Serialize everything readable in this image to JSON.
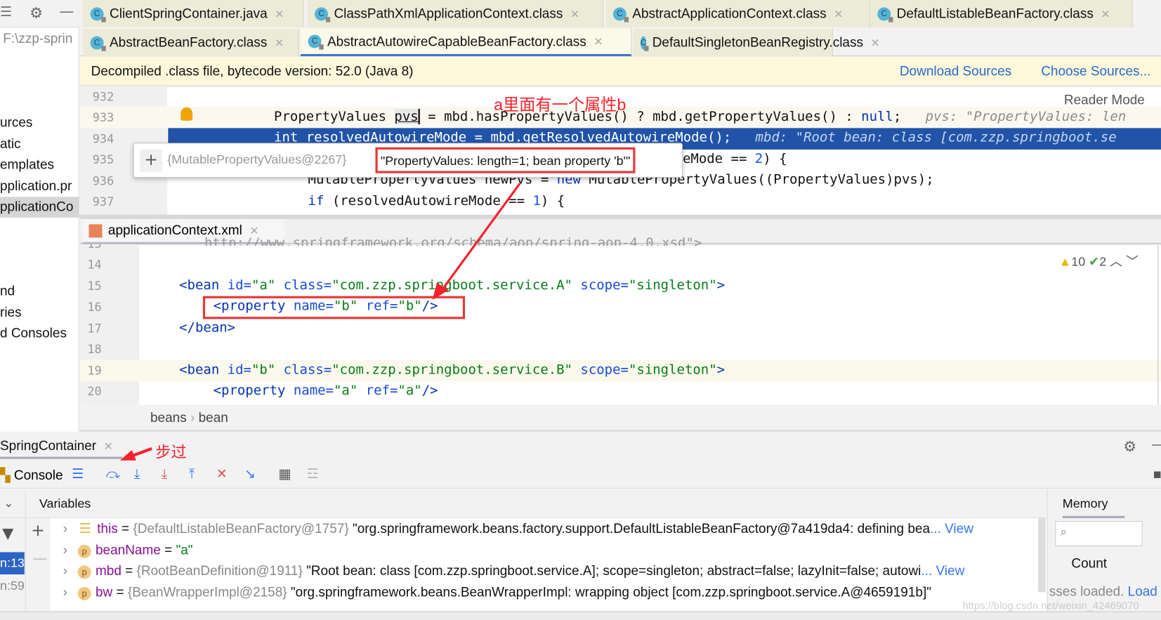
{
  "project_panel": {
    "path": "F:\\zzp-sprin",
    "items": [
      "urces",
      "atic",
      "emplates",
      "pplication.pr",
      "pplicationCo"
    ],
    "items2": [
      "nd",
      "ries",
      "d Consoles"
    ]
  },
  "tabs_row1": [
    {
      "label": "ClientSpringContainer.java"
    },
    {
      "label": "ClassPathXmlApplicationContext.class"
    },
    {
      "label": "AbstractApplicationContext.class"
    },
    {
      "label": "DefaultListableBeanFactory.class"
    }
  ],
  "tabs_row2": [
    {
      "label": "AbstractBeanFactory.class"
    },
    {
      "label": "AbstractAutowireCapableBeanFactory.class",
      "active": true
    },
    {
      "label": "DefaultSingletonBeanRegistry.class"
    }
  ],
  "banner": {
    "text": "Decompiled .class file, bytecode version: 52.0 (Java 8)",
    "download": "Download Sources",
    "choose": "Choose Sources..."
  },
  "editor": {
    "reader_mode": "Reader Mode",
    "line_numbers": [
      "932",
      "933",
      "934",
      "935",
      "936",
      "937"
    ],
    "lines": {
      "l933": {
        "a": "PropertyValues ",
        "b": "pvs",
        "c": " = mbd.hasPropertyValues() ? mbd.getPropertyValues() : ",
        "d": "null",
        "e": ";",
        "hint": "pvs: \"PropertyValues: len"
      },
      "l934": {
        "a": "int resolvedAutowireMode = mbd.getResolvedAutowireMode();",
        "hint": "mbd: \"Root bean: class [com.zzp.springboot.se"
      },
      "l935": {
        "a": "eMode == ",
        "b": "2",
        "c": ") {"
      },
      "l936": {
        "a": "MutablePropertyValues newPvs = ",
        "b": "new",
        "c": " MutablePropertyValues((PropertyValues)pvs);"
      },
      "l937": {
        "a": "if",
        "b": " (resolvedAutowireMode == ",
        "c": "1",
        "d": ") {"
      }
    }
  },
  "popup": {
    "ref": "{MutablePropertyValues@2267}",
    "value": "\"PropertyValues: length=1; bean property 'b'\""
  },
  "annotations": {
    "top": "a里面有一个属性b",
    "step": "步过",
    "color": "#f5222d"
  },
  "xml": {
    "tab": "applicationContext.xml",
    "warnings": "10",
    "typos": "2",
    "line_numbers": [
      "13",
      "14",
      "15",
      "16",
      "17",
      "18",
      "19",
      "20"
    ],
    "line13": "http://www.springframework.org/schema/aop/spring-aop-4.0.xsd\">",
    "bean_a": {
      "id": "a",
      "class": "com.zzp.springboot.service.A",
      "scope": "singleton"
    },
    "prop_a": {
      "name": "b",
      "ref": "b"
    },
    "bean_b": {
      "id": "b",
      "class": "com.zzp.springboot.service.B",
      "scope": "singleton"
    },
    "prop_b": {
      "name": "a",
      "ref": "a"
    },
    "close": "</bean>"
  },
  "breadcrumb": [
    "beans",
    "bean"
  ],
  "debug": {
    "title": "SpringContainer",
    "console": "Console",
    "variables": "Variables",
    "memory": "Memory",
    "count": "Count",
    "classes_loaded": "sses loaded.",
    "load": "Load",
    "frames": [
      "n:13",
      "n:59"
    ],
    "vars": [
      {
        "name": "this",
        "ref": "{DefaultListableBeanFactory@1757}",
        "value": "\"org.springframework.beans.factory.support.DefaultListableBeanFactory@7a419da4: defining bea",
        "more": "... View"
      },
      {
        "name": "beanName",
        "ref": "",
        "value": "\"a\"",
        "more": ""
      },
      {
        "name": "mbd",
        "ref": "{RootBeanDefinition@1911}",
        "value": "\"Root bean: class [com.zzp.springboot.service.A]; scope=singleton; abstract=false; lazyInit=false; autowi",
        "more": "... View"
      },
      {
        "name": "bw",
        "ref": "{BeanWrapperImpl@2158}",
        "value": "\"org.springframework.beans.BeanWrapperImpl: wrapping object [com.zzp.springboot.service.A@4659191b]\"",
        "more": ""
      }
    ]
  },
  "watermark": "https://blog.csdn.net/weixin_42469070"
}
